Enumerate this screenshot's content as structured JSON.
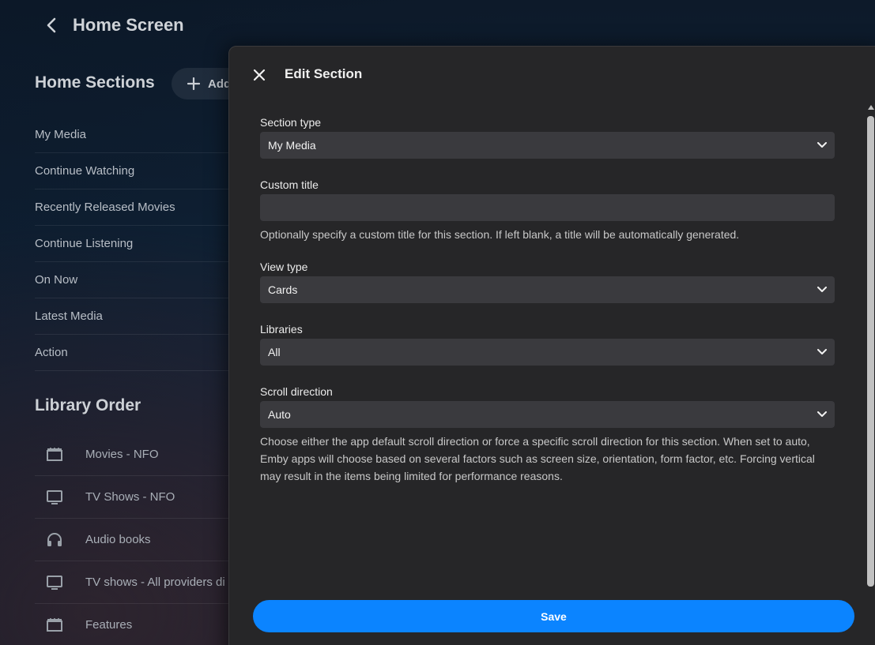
{
  "header": {
    "title": "Home Screen"
  },
  "home_sections": {
    "heading": "Home Sections",
    "add_label": "Add",
    "items": [
      "My Media",
      "Continue Watching",
      "Recently Released Movies",
      "Continue Listening",
      "On Now",
      "Latest Media",
      "Action"
    ]
  },
  "library_order": {
    "heading": "Library Order",
    "items": [
      {
        "label": "Movies - NFO",
        "icon": "movie-icon"
      },
      {
        "label": "TV Shows - NFO",
        "icon": "tv-icon"
      },
      {
        "label": "Audio books",
        "icon": "headphones-icon"
      },
      {
        "label": "TV shows - All providers di",
        "icon": "tv-icon"
      },
      {
        "label": "Features",
        "icon": "movie-icon"
      }
    ]
  },
  "dialog": {
    "title": "Edit Section",
    "section_type": {
      "label": "Section type",
      "value": "My Media"
    },
    "custom_title": {
      "label": "Custom title",
      "value": "",
      "help": "Optionally specify a custom title for this section. If left blank, a title will be automatically generated."
    },
    "view_type": {
      "label": "View type",
      "value": "Cards"
    },
    "libraries": {
      "label": "Libraries",
      "value": "All"
    },
    "scroll_direction": {
      "label": "Scroll direction",
      "value": "Auto",
      "help": "Choose either the app default scroll direction or force a specific scroll direction for this section. When set to auto, Emby apps will choose based on several factors such as screen size, orientation, form factor, etc. Forcing vertical may result in the items being limited for performance reasons."
    },
    "save_label": "Save"
  },
  "colors": {
    "accent": "#0b84ff",
    "dialog_bg": "#262628",
    "field_bg": "#3a3a3e"
  }
}
